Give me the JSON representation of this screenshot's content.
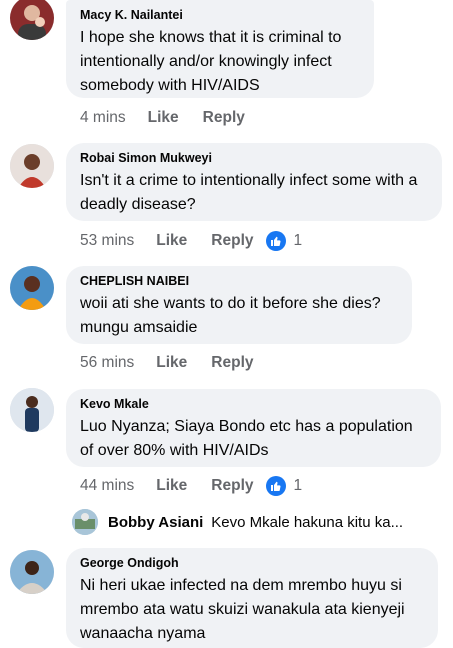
{
  "comments": [
    {
      "author": "Macy K. Nailantei",
      "text": "I hope she knows that it is criminal to intentionally and/or knowingly infect somebody with HIV/AIDS",
      "time": "4 mins",
      "like": "Like",
      "reply": "Reply",
      "reactions": null
    },
    {
      "author": "Robai Simon Mukweyi",
      "text": "Isn't it a crime to intentionally infect some with a deadly disease?",
      "time": "53 mins",
      "like": "Like",
      "reply": "Reply",
      "reactions": "1"
    },
    {
      "author": "CHEPLISH NAIBEI",
      "text": "woii ati she wants to do it before she dies? mungu amsaidie",
      "time": "56 mins",
      "like": "Like",
      "reply": "Reply",
      "reactions": null
    },
    {
      "author": "Kevo Mkale",
      "text": "Luo Nyanza; Siaya Bondo etc has a population of over 80% with HIV/AIDs",
      "time": "44 mins",
      "like": "Like",
      "reply": "Reply",
      "reactions": "1"
    },
    {
      "author": "George Ondigoh",
      "text": "Ni heri ukae infected na dem mrembo huyu si mrembo ata watu skuizi wanakula ata kienyeji wanaacha nyama"
    }
  ],
  "reply_preview": {
    "author": "Bobby Asiani",
    "text": "Kevo Mkale hakuna kitu ka..."
  },
  "colors": {
    "bubble": "#f0f2f5",
    "meta": "#65676b",
    "like_blue": "#1877f2"
  }
}
